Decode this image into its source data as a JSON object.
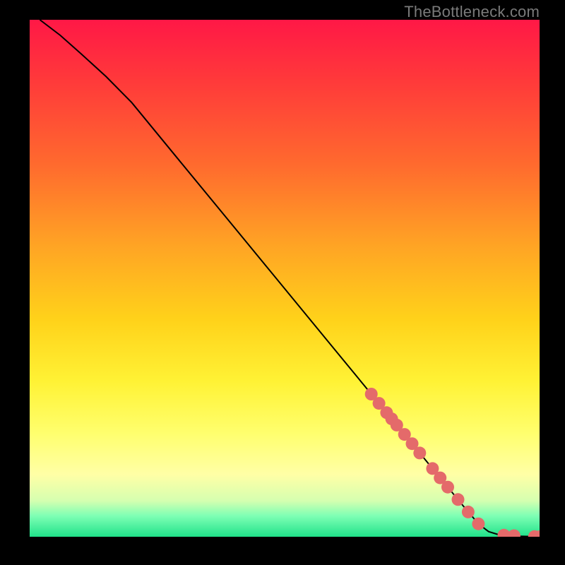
{
  "watermark": "TheBottleneck.com",
  "chart_data": {
    "type": "line",
    "xlim": [
      0,
      100
    ],
    "ylim": [
      0,
      100
    ],
    "xlabel": "",
    "ylabel": "",
    "title": "",
    "line": {
      "x": [
        2,
        6,
        10,
        15,
        20,
        30,
        40,
        50,
        60,
        70,
        75,
        80,
        85,
        88,
        90,
        92,
        94,
        96,
        98,
        100
      ],
      "y": [
        100,
        97,
        93.5,
        89,
        84,
        72,
        60,
        48,
        36,
        24,
        18,
        12,
        6,
        2.5,
        1,
        0.4,
        0.2,
        0.1,
        0.05,
        0
      ]
    },
    "markers": {
      "x": [
        67,
        68.5,
        70,
        71,
        72,
        73.5,
        75,
        76.5,
        79,
        80.5,
        82,
        84,
        86,
        88,
        93,
        95,
        99,
        100
      ],
      "y": [
        27.6,
        25.8,
        24,
        22.8,
        21.6,
        19.8,
        18,
        16.2,
        13.2,
        11.4,
        9.6,
        7.2,
        4.8,
        2.5,
        0.3,
        0.2,
        0.03,
        0
      ]
    },
    "colors": {
      "line": "#000000",
      "marker": "#e46a6a"
    }
  }
}
